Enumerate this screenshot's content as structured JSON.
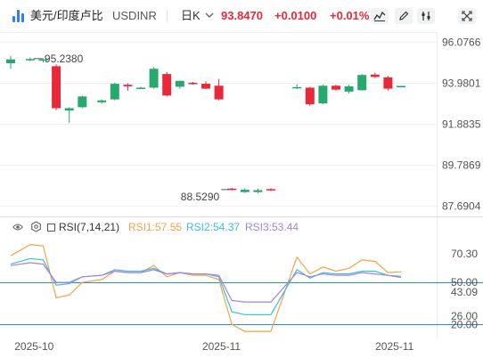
{
  "toolbar": {
    "pair_name": "美元/印度卢比",
    "symbol": "USDINR",
    "interval": "日K",
    "last_price": "93.8470",
    "change": "+0.0100",
    "change_pct": "+0.01%"
  },
  "icons": [
    "logo-bars-icon",
    "chevron-down-icon",
    "line-chart-icon",
    "pencil-icon",
    "settings-sliders-icon",
    "fullscreen-icon",
    "eye-icon",
    "gear-icon"
  ],
  "colors": {
    "up": "#26a96d",
    "down": "#e8293a",
    "price_text": "#e8293a",
    "rsi1": "#f2a444",
    "rsi2": "#3cbed8",
    "rsi3": "#a783d8",
    "blue_line": "#2b8cd8"
  },
  "chart_data": [
    {
      "type": "candlestick",
      "ylim": [
        87.2,
        96.6
      ],
      "price_labels": [
        "96.0766",
        "93.9801",
        "91.8835",
        "89.7869",
        "87.6904"
      ],
      "price_label_values": [
        96.0766,
        93.9801,
        91.8835,
        89.7869,
        87.6904
      ],
      "annotations": [
        {
          "text": "95.2380",
          "value": 95.238
        },
        {
          "text": "88.5290",
          "value": 88.529
        }
      ],
      "candles": [
        {
          "x": 0,
          "o": 95.0,
          "h": 95.38,
          "l": 94.72,
          "c": 95.2
        },
        {
          "x": 1.5,
          "o": 95.2,
          "h": 95.3,
          "l": 95.1,
          "c": 95.22
        },
        {
          "x": 2.5,
          "o": 95.18,
          "h": 95.25,
          "l": 95.05,
          "c": 95.2
        },
        {
          "x": 3.5,
          "o": 94.85,
          "h": 94.95,
          "l": 92.6,
          "c": 92.7
        },
        {
          "x": 4.5,
          "o": 92.58,
          "h": 92.75,
          "l": 91.95,
          "c": 92.7
        },
        {
          "x": 5.5,
          "o": 92.75,
          "h": 93.35,
          "l": 92.7,
          "c": 93.3
        },
        {
          "x": 7,
          "o": 93.0,
          "h": 93.15,
          "l": 92.92,
          "c": 93.1
        },
        {
          "x": 8,
          "o": 93.15,
          "h": 94.0,
          "l": 93.1,
          "c": 93.95
        },
        {
          "x": 9,
          "o": 93.9,
          "h": 93.98,
          "l": 93.6,
          "c": 93.82
        },
        {
          "x": 10,
          "o": 93.75,
          "h": 93.8,
          "l": 93.7,
          "c": 93.75
        },
        {
          "x": 11,
          "o": 93.75,
          "h": 94.8,
          "l": 93.7,
          "c": 94.72
        },
        {
          "x": 12,
          "o": 94.45,
          "h": 94.55,
          "l": 93.3,
          "c": 93.35
        },
        {
          "x": 13,
          "o": 93.8,
          "h": 94.1,
          "l": 93.7,
          "c": 94.1
        },
        {
          "x": 14,
          "o": 94.0,
          "h": 94.05,
          "l": 93.9,
          "c": 93.95
        },
        {
          "x": 15,
          "o": 93.95,
          "h": 94.08,
          "l": 93.68,
          "c": 93.7
        },
        {
          "x": 16,
          "o": 93.85,
          "h": 94.2,
          "l": 93.1,
          "c": 93.15
        },
        {
          "x": 17,
          "o": 88.58,
          "h": 88.62,
          "l": 88.48,
          "c": 88.53
        },
        {
          "x": 18,
          "o": 88.4,
          "h": 88.6,
          "l": 88.35,
          "c": 88.52
        },
        {
          "x": 19,
          "o": 88.4,
          "h": 88.58,
          "l": 88.35,
          "c": 88.5
        },
        {
          "x": 20,
          "o": 88.55,
          "h": 88.6,
          "l": 88.45,
          "c": 88.5
        },
        {
          "x": 22,
          "o": 93.75,
          "h": 93.92,
          "l": 93.68,
          "c": 93.78
        },
        {
          "x": 23,
          "o": 93.75,
          "h": 93.8,
          "l": 92.82,
          "c": 92.9
        },
        {
          "x": 24,
          "o": 92.95,
          "h": 93.9,
          "l": 92.9,
          "c": 93.85
        },
        {
          "x": 25,
          "o": 93.85,
          "h": 93.9,
          "l": 93.6,
          "c": 93.65
        },
        {
          "x": 26,
          "o": 93.55,
          "h": 93.9,
          "l": 93.45,
          "c": 93.82
        },
        {
          "x": 27,
          "o": 93.62,
          "h": 94.45,
          "l": 93.6,
          "c": 94.4
        },
        {
          "x": 28,
          "o": 94.42,
          "h": 94.52,
          "l": 94.25,
          "c": 94.3
        },
        {
          "x": 29,
          "o": 94.28,
          "h": 94.35,
          "l": 93.6,
          "c": 93.7
        },
        {
          "x": 30,
          "o": 93.82,
          "h": 93.85,
          "l": 93.8,
          "c": 93.84
        }
      ]
    },
    {
      "type": "line",
      "indicator_label": "RSI(7,14,21)",
      "ylim": [
        10,
        85
      ],
      "axis_labels": [
        "70.30",
        "50.00",
        "43.09",
        "26.00",
        "20.00"
      ],
      "axis_label_values": [
        70.3,
        50.0,
        43.09,
        26.0,
        20.0
      ],
      "hlines": [
        50,
        20
      ],
      "x_tick_labels": [
        {
          "x": 1.8,
          "text": "2025-10"
        },
        {
          "x": 16.2,
          "text": "2025-11"
        },
        {
          "x": 29.5,
          "text": "2025-11"
        }
      ],
      "series": [
        {
          "name": "RSI1",
          "legend": "RSI1:57.55",
          "x": [
            0,
            1.5,
            2.5,
            3.5,
            4.5,
            5.5,
            7,
            8,
            9,
            10,
            11,
            12,
            13,
            14,
            15,
            16,
            17,
            18,
            19,
            20,
            22,
            23,
            24,
            25,
            26,
            27,
            28,
            29,
            30
          ],
          "values": [
            69,
            77,
            76,
            39,
            41,
            50,
            52,
            58,
            57,
            57,
            62,
            54,
            57,
            55,
            55,
            52,
            20,
            15,
            15,
            15,
            68,
            56,
            61,
            58,
            60,
            66,
            65,
            57,
            57.55
          ]
        },
        {
          "name": "RSI2",
          "legend": "RSI2:54.37",
          "x": [
            0,
            1.5,
            2.5,
            3.5,
            4.5,
            5.5,
            7,
            8,
            9,
            10,
            11,
            12,
            13,
            14,
            15,
            16,
            17,
            18,
            19,
            20,
            22,
            23,
            24,
            25,
            26,
            27,
            28,
            29,
            30
          ],
          "values": [
            63,
            67,
            66,
            48,
            49,
            54,
            55,
            59,
            58,
            58,
            60,
            56,
            57,
            56,
            56,
            54,
            29,
            27,
            27,
            27,
            59,
            53,
            57,
            56,
            56,
            58,
            58,
            55,
            54.37
          ]
        },
        {
          "name": "RSI3",
          "legend": "RSI3:53.44",
          "x": [
            0,
            1.5,
            2.5,
            3.5,
            4.5,
            5.5,
            7,
            8,
            9,
            10,
            11,
            12,
            13,
            14,
            15,
            16,
            17,
            18,
            19,
            20,
            22,
            23,
            24,
            25,
            26,
            27,
            28,
            29,
            30
          ],
          "values": [
            62,
            64,
            63,
            50,
            50,
            54,
            55,
            58,
            57,
            57,
            59,
            56,
            57,
            56,
            56,
            55,
            37,
            36,
            36,
            36,
            57,
            54,
            56,
            55,
            55,
            57,
            56,
            55,
            53.44
          ]
        }
      ]
    }
  ]
}
